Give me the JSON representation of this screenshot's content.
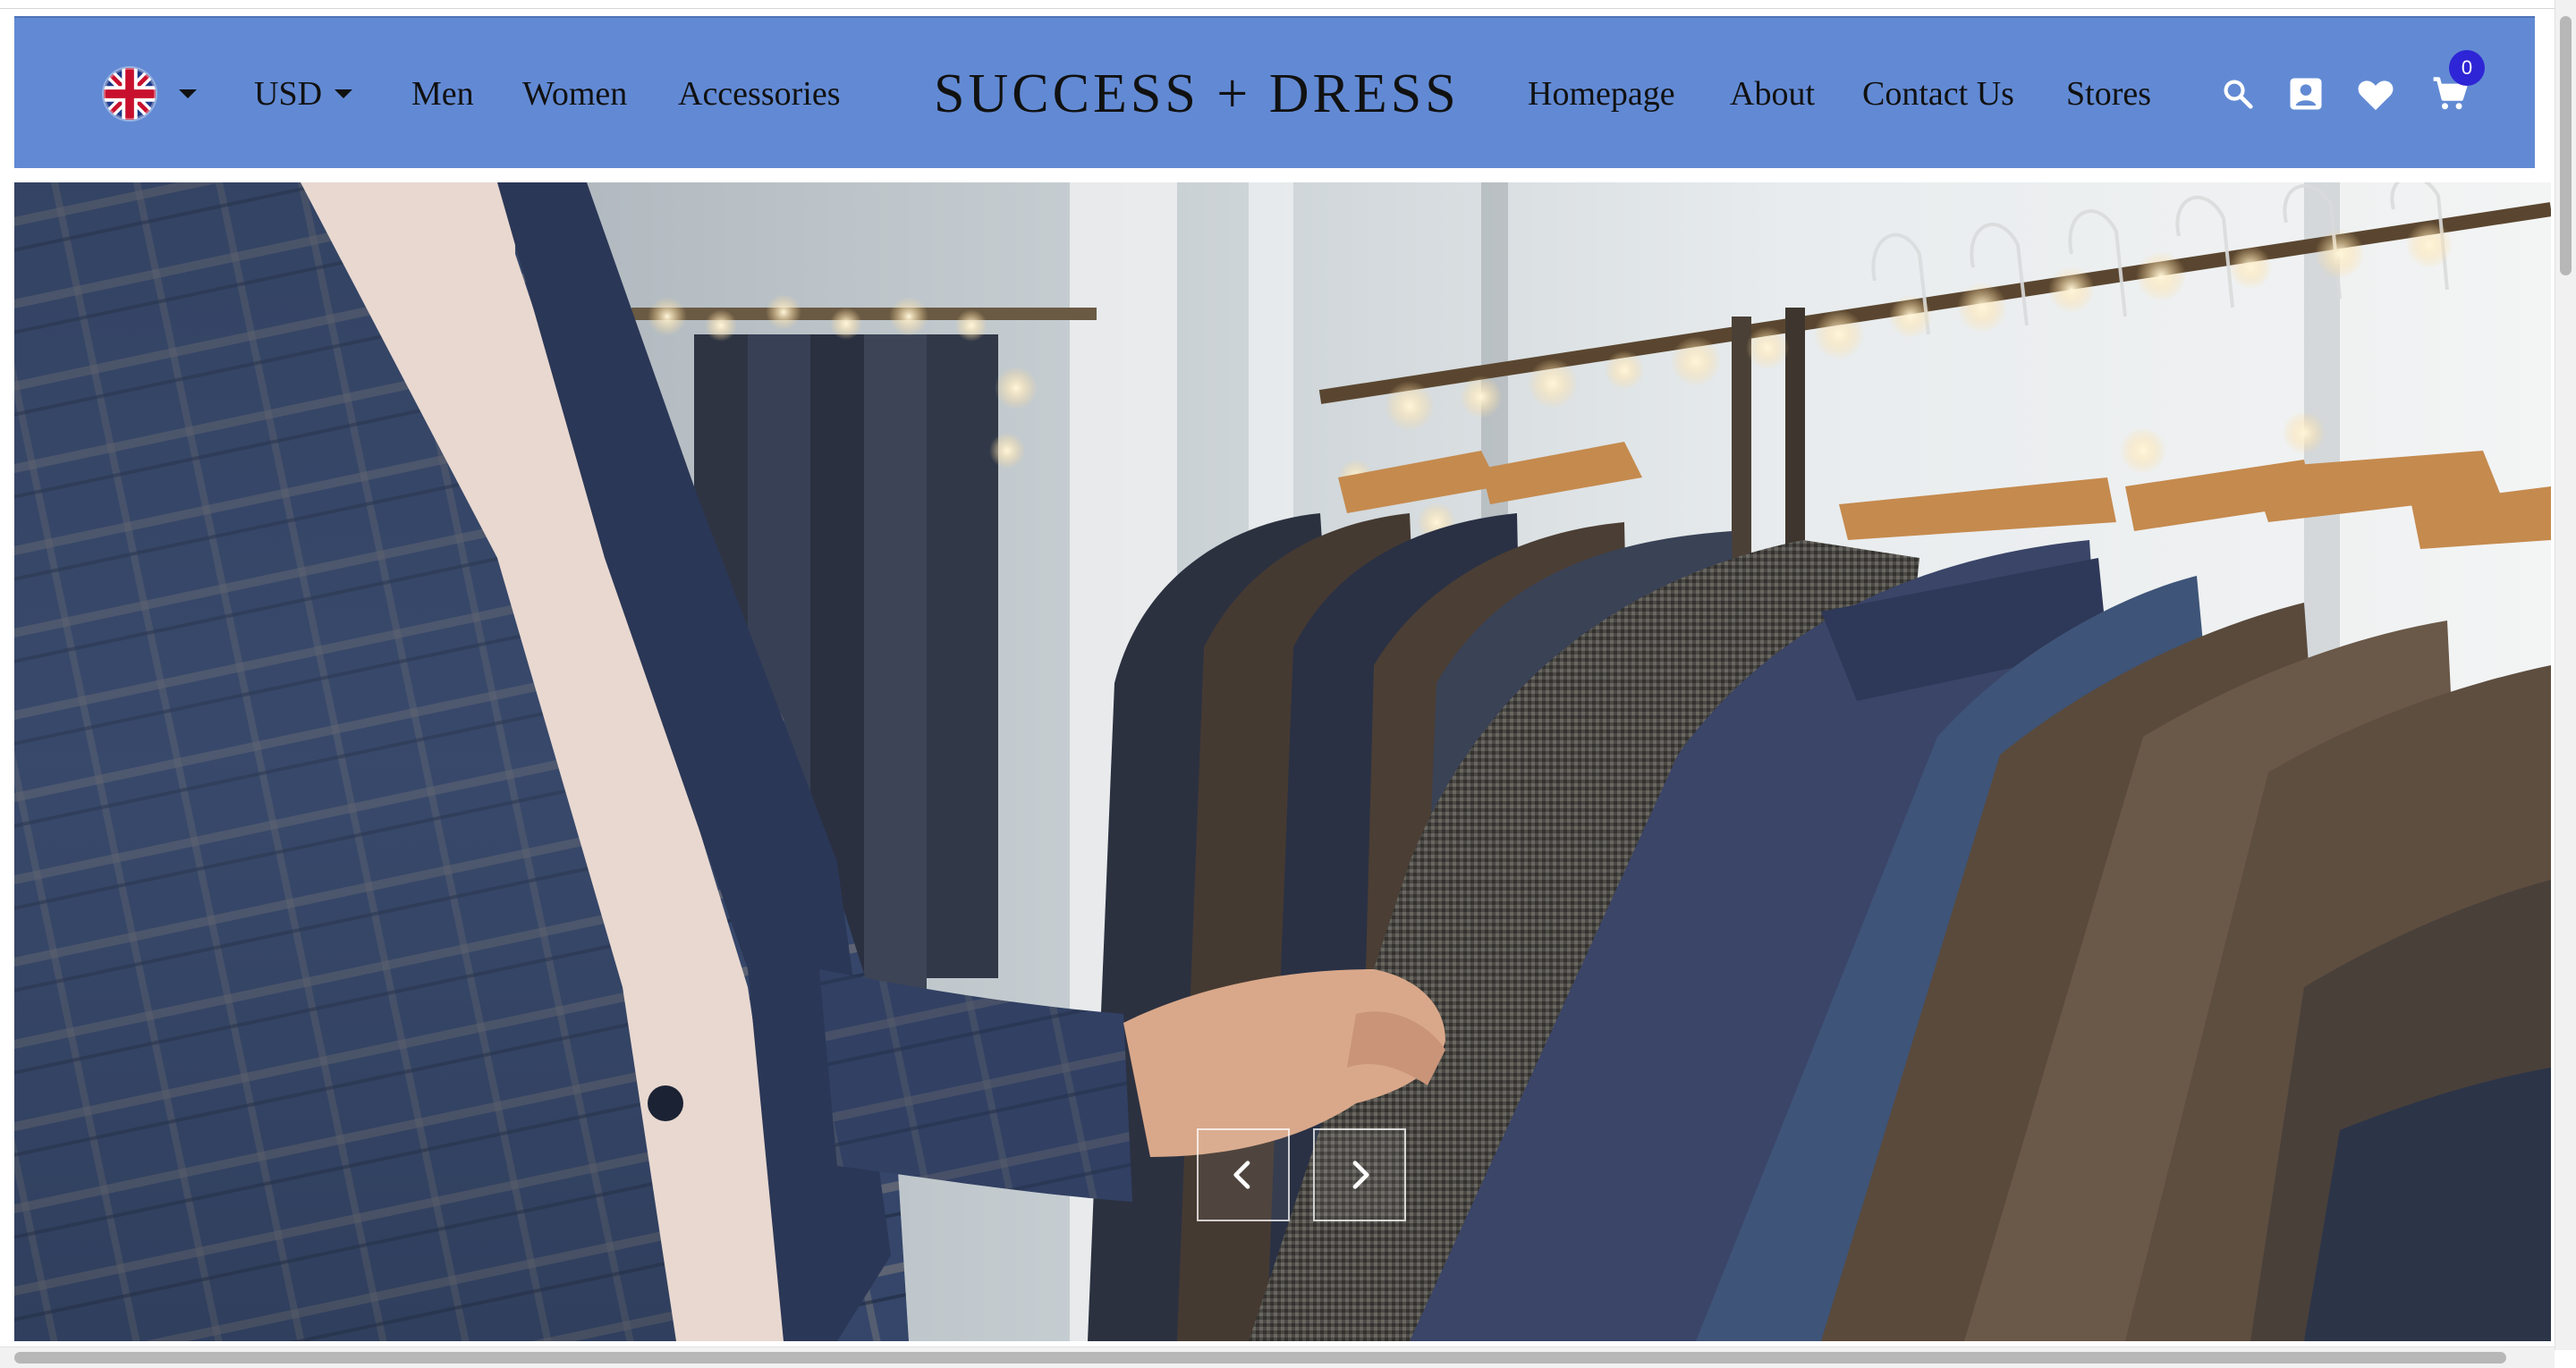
{
  "header": {
    "language": {
      "flag": "uk-flag-icon"
    },
    "currency": {
      "label": "USD"
    },
    "left_nav": [
      {
        "label": "Men"
      },
      {
        "label": "Women"
      },
      {
        "label": "Accessories"
      }
    ],
    "brand": "SUCCESS + DRESS",
    "right_nav": [
      {
        "label": "Homepage"
      },
      {
        "label": "About"
      },
      {
        "label": "Contact Us"
      },
      {
        "label": "Stores"
      }
    ],
    "icons": {
      "search": "search-icon",
      "account": "account-icon",
      "wishlist": "heart-icon",
      "cart": "cart-icon"
    },
    "cart_count": "0"
  },
  "hero": {
    "image": "man browsing suit jackets on clothing rack",
    "prev_icon": "chevron-left-icon",
    "next_icon": "chevron-right-icon"
  },
  "colors": {
    "header_bg": "#628ad4",
    "cart_badge": "#2e25d6"
  }
}
